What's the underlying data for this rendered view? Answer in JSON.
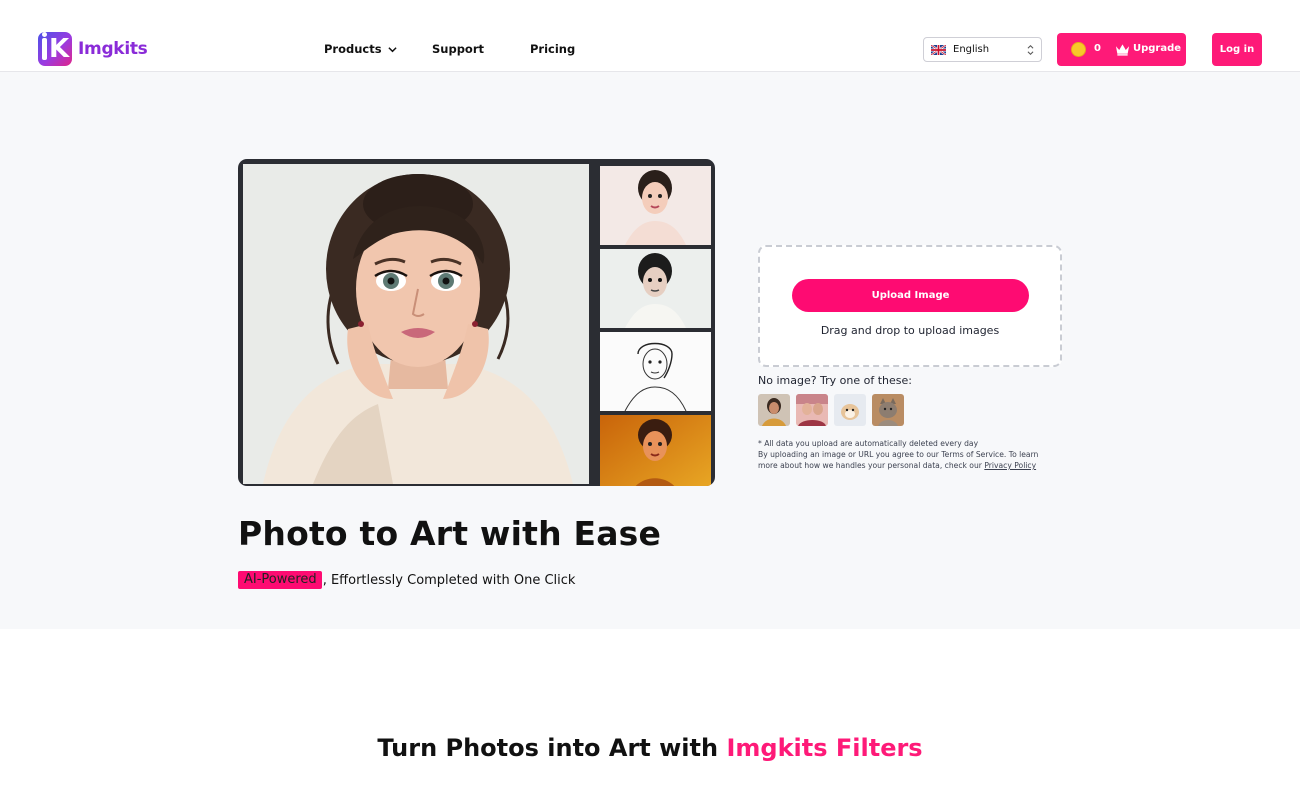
{
  "header": {
    "brand": "Imgkits",
    "nav": {
      "products": "Products",
      "support": "Support",
      "pricing": "Pricing"
    },
    "language": {
      "selected": "English",
      "flag_icon": "uk-flag-icon"
    },
    "credits": {
      "count": "0",
      "upgrade_label": "Upgrade"
    },
    "login_label": "Log in"
  },
  "hero": {
    "title": "Photo to Art with Ease",
    "badge": "AI-Powered",
    "subtitle_rest": ", Effortlessly Completed with One Click",
    "upload": {
      "button_label": "Upload Image",
      "drag_text": "Drag and drop to upload images"
    },
    "samples_label": "No image? Try one of these:",
    "samples": [
      "sample-portrait",
      "sample-couple",
      "sample-dog",
      "sample-cat"
    ],
    "fine_print": {
      "line1": "* All data you upload are automatically deleted every day",
      "line2": "By uploading an image or URL you agree to our Terms of Service. To learn",
      "line3": "more about how we handles your personal data, check our",
      "privacy_link": "Privacy Policy"
    }
  },
  "section2": {
    "title_plain": "Turn Photos into Art with ",
    "title_accent": "Imgkits Filters"
  },
  "colors": {
    "primary": "#fe1a78",
    "hero_bg": "#f7f8fa",
    "brand_purple": "#8a2bd8"
  }
}
